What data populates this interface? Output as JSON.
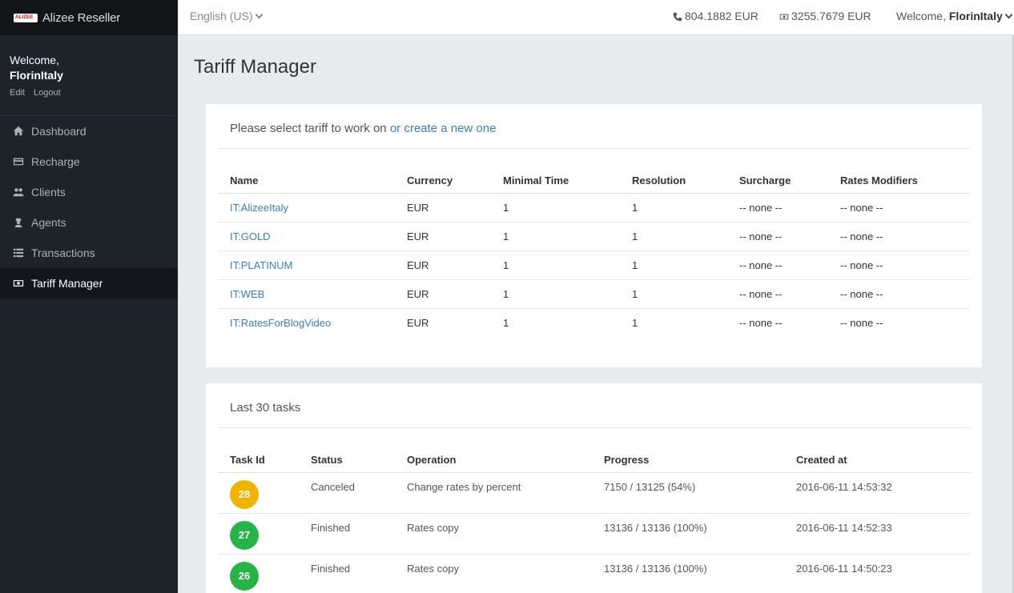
{
  "brand": {
    "logo_text": "ALIZEE",
    "name": "Alizee Reseller"
  },
  "sidebar": {
    "welcome": "Welcome,",
    "username": "FlorinItaly",
    "edit": "Edit",
    "logout": "Logout",
    "items": [
      {
        "label": "Dashboard",
        "icon": "home-icon"
      },
      {
        "label": "Recharge",
        "icon": "credit-card-icon"
      },
      {
        "label": "Clients",
        "icon": "users-icon"
      },
      {
        "label": "Agents",
        "icon": "user-secret-icon"
      },
      {
        "label": "Transactions",
        "icon": "list-icon"
      },
      {
        "label": "Tariff Manager",
        "icon": "money-icon",
        "active": true
      }
    ]
  },
  "topbar": {
    "language": "English (US)",
    "balance_phone": "804.1882 EUR",
    "balance_money": "3255.7679 EUR",
    "welcome": "Welcome, ",
    "username": "FlorinItaly"
  },
  "page": {
    "title": "Tariff Manager"
  },
  "tariffs": {
    "prompt": "Please select tariff to work on ",
    "create_link": "or create a new one",
    "columns": [
      "Name",
      "Currency",
      "Minimal Time",
      "Resolution",
      "Surcharge",
      "Rates Modifiers"
    ],
    "rows": [
      [
        "IT:AlizeeItaly",
        "EUR",
        "1",
        "1",
        "-- none --",
        "-- none --"
      ],
      [
        "IT:GOLD",
        "EUR",
        "1",
        "1",
        "-- none --",
        "-- none --"
      ],
      [
        "IT:PLATINUM",
        "EUR",
        "1",
        "1",
        "-- none --",
        "-- none --"
      ],
      [
        "IT:WEB",
        "EUR",
        "1",
        "1",
        "-- none --",
        "-- none --"
      ],
      [
        "IT:RatesForBlogVideo",
        "EUR",
        "1",
        "1",
        "-- none --",
        "-- none --"
      ]
    ]
  },
  "tasks": {
    "title": "Last 30 tasks",
    "columns": [
      "Task Id",
      "Status",
      "Operation",
      "Progress",
      "Created at"
    ],
    "rows": [
      {
        "id": "28",
        "status": "Canceled",
        "operation": "Change rates by percent",
        "progress": "7150 / 13125 (54%)",
        "created": "2016-06-11 14:53:32",
        "color": "#f0b400"
      },
      {
        "id": "27",
        "status": "Finished",
        "operation": "Rates copy",
        "progress": "13136 / 13136 (100%)",
        "created": "2016-06-11 14:52:33",
        "color": "#27b446"
      },
      {
        "id": "26",
        "status": "Finished",
        "operation": "Rates copy",
        "progress": "13136 / 13136 (100%)",
        "created": "2016-06-11 14:50:23",
        "color": "#27b446"
      }
    ]
  }
}
